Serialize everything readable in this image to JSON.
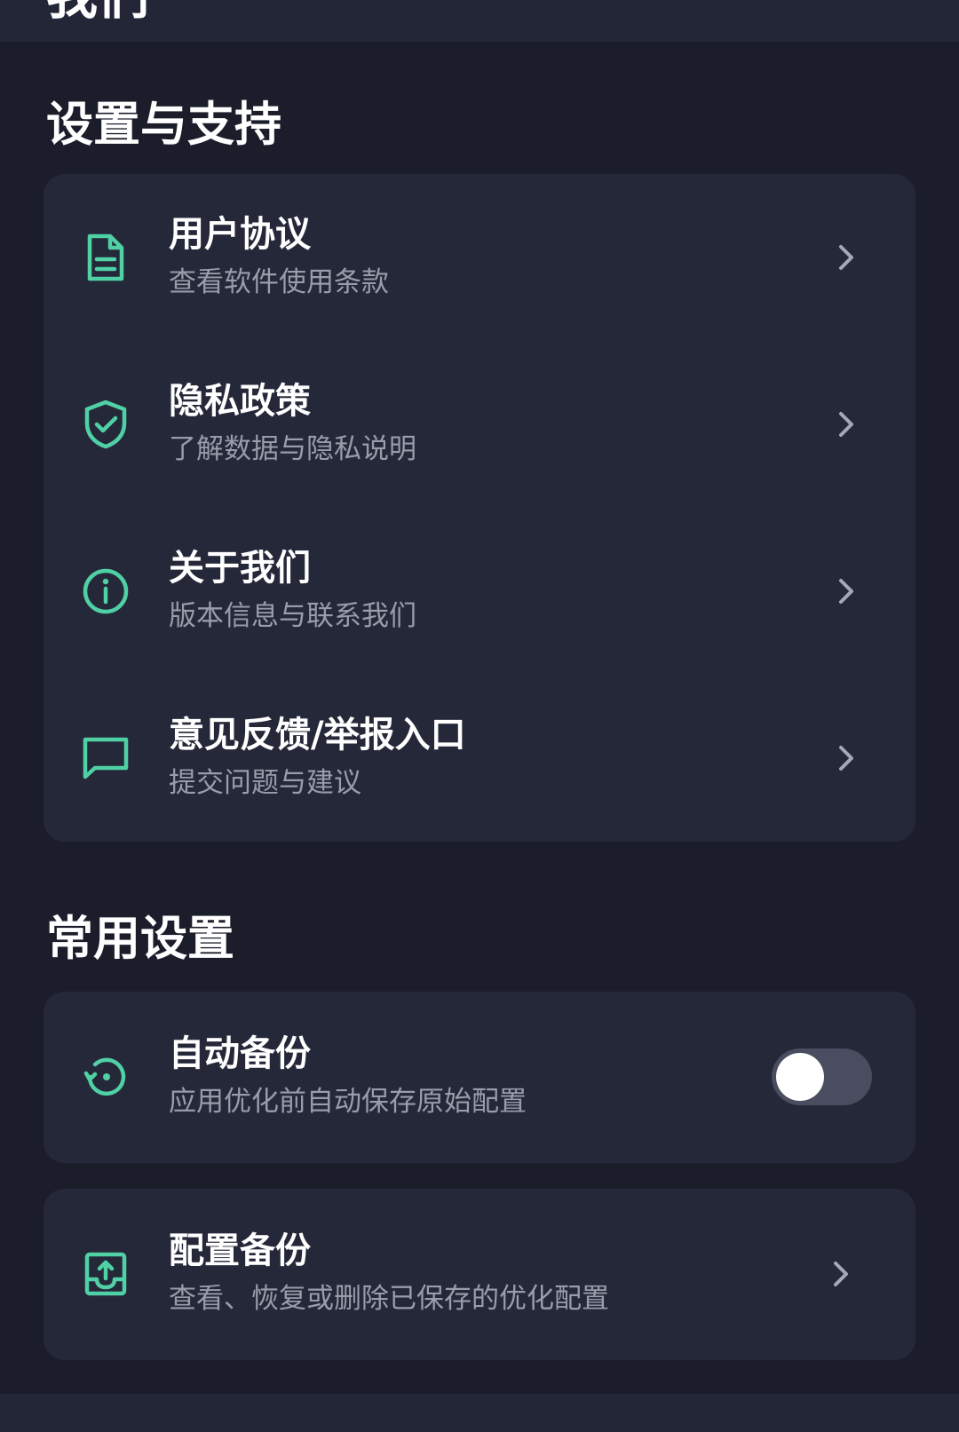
{
  "header": {
    "title": "我们"
  },
  "colors": {
    "background": "#1b1d2b",
    "card": "#252839",
    "accent": "#4fd1a5",
    "subtitle": "#9a9caa",
    "toggle_off": "#4a4d5f"
  },
  "support": {
    "section_title": "设置与支持",
    "items": [
      {
        "icon": "document-icon",
        "title": "用户协议",
        "subtitle": "查看软件使用条款"
      },
      {
        "icon": "shield-check-icon",
        "title": "隐私政策",
        "subtitle": "了解数据与隐私说明"
      },
      {
        "icon": "info-icon",
        "title": "关于我们",
        "subtitle": "版本信息与联系我们"
      },
      {
        "icon": "message-icon",
        "title": "意见反馈/举报入口",
        "subtitle": "提交问题与建议"
      }
    ]
  },
  "common": {
    "section_title": "常用设置",
    "auto_backup": {
      "icon": "restore-icon",
      "title": "自动备份",
      "subtitle": "应用优化前自动保存原始配置",
      "enabled": false
    },
    "config_backup": {
      "icon": "upload-tray-icon",
      "title": "配置备份",
      "subtitle": "查看、恢复或删除已保存的优化配置"
    }
  }
}
